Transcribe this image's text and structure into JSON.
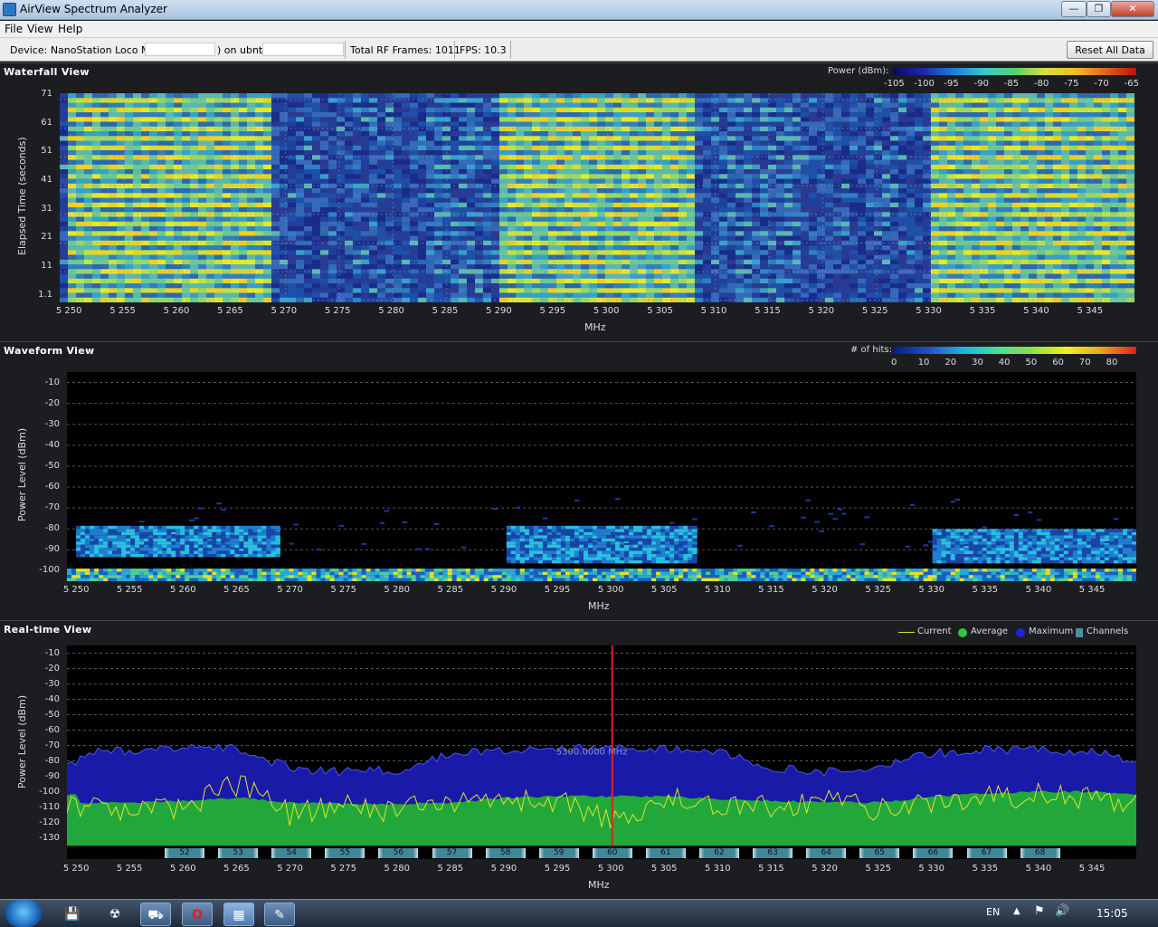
{
  "window": {
    "title": "AirView Spectrum Analyzer",
    "minimize": "—",
    "maximize": "❐",
    "close": "✕"
  },
  "menu": [
    "File",
    "View",
    "Help"
  ],
  "toolbar": {
    "device_prefix": "Device: NanoStation Loco M5 (",
    "device_mid": ") on ubnt:/,",
    "frames": "Total RF Frames: 1011",
    "fps": "FPS: 10.3",
    "reset": "Reset All Data"
  },
  "xaxis": {
    "title": "MHz",
    "ticks": [
      "5 250",
      "5 255",
      "5 260",
      "5 265",
      "5 270",
      "5 275",
      "5 280",
      "5 285",
      "5 290",
      "5 295",
      "5 300",
      "5 305",
      "5 310",
      "5 315",
      "5 320",
      "5 325",
      "5 330",
      "5 335",
      "5 340",
      "5 345"
    ]
  },
  "waterfall": {
    "title": "Waterfall View",
    "ylabel": "Elapsed Time (seconds)",
    "yticks": [
      "71",
      "61",
      "51",
      "41",
      "31",
      "21",
      "11",
      "1.1"
    ],
    "legend_label": "Power (dBm):",
    "legend_ticks": [
      "-105",
      "-100",
      "-95",
      "-90",
      "-85",
      "-80",
      "-75",
      "-70",
      "-65"
    ]
  },
  "waveform": {
    "title": "Waveform View",
    "ylabel": "Power Level (dBm)",
    "yticks": [
      "-10",
      "-20",
      "-30",
      "-40",
      "-50",
      "-60",
      "-70",
      "-80",
      "-90",
      "-100"
    ],
    "legend_label": "# of hits:",
    "legend_ticks": [
      "0",
      "10",
      "20",
      "30",
      "40",
      "50",
      "60",
      "70",
      "80"
    ]
  },
  "realtime": {
    "title": "Real-time View",
    "ylabel": "Power Level (dBm)",
    "yticks": [
      "-10",
      "-20",
      "-30",
      "-40",
      "-50",
      "-60",
      "-70",
      "-80",
      "-90",
      "-100",
      "-110",
      "-120",
      "-130"
    ],
    "legend": {
      "current": "Current",
      "average": "Average",
      "maximum": "Maximum",
      "channels": "Channels"
    },
    "cursor_label": "5300.0000 MHz",
    "channels": [
      "52",
      "53",
      "54",
      "55",
      "56",
      "57",
      "58",
      "59",
      "60",
      "61",
      "62",
      "63",
      "64",
      "65",
      "66",
      "67",
      "68"
    ]
  },
  "chart_data": [
    {
      "type": "heatmap",
      "title": "Waterfall View",
      "xlabel": "MHz",
      "ylabel": "Elapsed Time (seconds)",
      "xlim": [
        5249,
        5349
      ],
      "ylim": [
        0,
        71
      ],
      "colorbar": {
        "label": "Power (dBm):",
        "range": [
          -105,
          -65
        ]
      },
      "active_bands_mhz": [
        [
          5250,
          5269
        ],
        [
          5290,
          5308
        ],
        [
          5330,
          5349
        ]
      ],
      "weaker_bands_mhz": [
        [
          5283,
          5290
        ],
        [
          5310,
          5318
        ]
      ]
    },
    {
      "type": "heatmap",
      "title": "Waveform View",
      "xlabel": "MHz",
      "ylabel": "Power Level (dBm)",
      "xlim": [
        5249,
        5349
      ],
      "ylim": [
        -105,
        -5
      ],
      "colorbar": {
        "label": "# of hits:",
        "range": [
          0,
          85
        ]
      },
      "bands": [
        {
          "x": [
            5250,
            5269
          ],
          "level_dbm": [
            -92,
            -78
          ]
        },
        {
          "x": [
            5290,
            5308
          ],
          "level_dbm": [
            -95,
            -78
          ]
        },
        {
          "x": [
            5330,
            5349
          ],
          "level_dbm": [
            -95,
            -80
          ]
        }
      ],
      "noise_floor_dbm": -102
    },
    {
      "type": "area",
      "title": "Real-time View",
      "xlabel": "MHz",
      "ylabel": "Power Level (dBm)",
      "xlim": [
        5249,
        5349
      ],
      "ylim": [
        -135,
        -5
      ],
      "cursor_mhz": 5300,
      "x": [
        5250,
        5255,
        5260,
        5265,
        5270,
        5275,
        5280,
        5285,
        5290,
        5295,
        5300,
        5305,
        5310,
        5315,
        5320,
        5325,
        5330,
        5335,
        5340,
        5345,
        5349
      ],
      "series": [
        {
          "name": "Maximum",
          "values": [
            -75,
            -73,
            -72,
            -72,
            -85,
            -87,
            -86,
            -75,
            -74,
            -72,
            -72,
            -72,
            -73,
            -85,
            -87,
            -84,
            -75,
            -73,
            -73,
            -74,
            -80
          ]
        },
        {
          "name": "Average",
          "values": [
            -107,
            -107,
            -106,
            -104,
            -107,
            -108,
            -108,
            -107,
            -104,
            -103,
            -103,
            -103,
            -105,
            -106,
            -107,
            -107,
            -103,
            -101,
            -100,
            -100,
            -102
          ]
        },
        {
          "name": "Current",
          "values": [
            -108,
            -112,
            -109,
            -95,
            -115,
            -110,
            -112,
            -108,
            -105,
            -106,
            -120,
            -104,
            -108,
            -110,
            -104,
            -112,
            -108,
            -104,
            -102,
            -105,
            -110
          ]
        }
      ]
    }
  ]
}
